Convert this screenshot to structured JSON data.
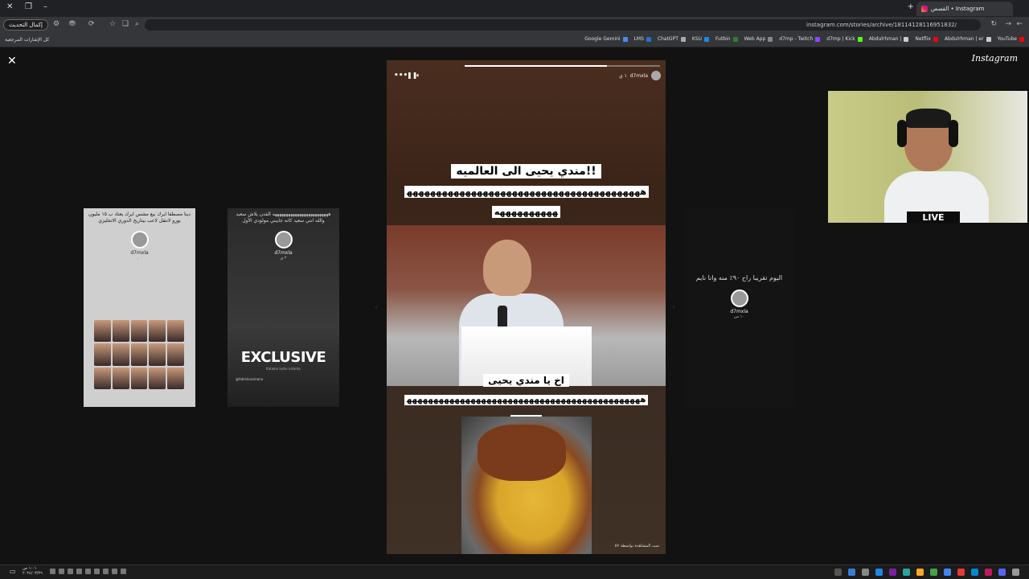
{
  "browser": {
    "tab_title": "القصص • Instagram",
    "url": "instagram.com/stories/archive/18114128116951832/",
    "update_button": "إكمال التحديث",
    "all_bookmarks": "كل الإشارات المرجعية",
    "bookmarks": [
      {
        "label": "Google Gemini",
        "color": "#4a8af4"
      },
      {
        "label": "LMS",
        "color": "#2c6fd1"
      },
      {
        "label": "ChatGPT",
        "color": "#aaaaaa"
      },
      {
        "label": "KSU",
        "color": "#1e88e5"
      },
      {
        "label": "Futbin",
        "color": "#2e7d32"
      },
      {
        "label": "Web App",
        "color": "#888888"
      },
      {
        "label": "d7mp - Twitch",
        "color": "#9146ff"
      },
      {
        "label": "d7mp | Kick",
        "color": "#53fc18"
      },
      {
        "label": "Abdulrhman |",
        "color": "#cccccc"
      },
      {
        "label": "Netflix",
        "color": "#e50914"
      },
      {
        "label": "Abdulrhman | er",
        "color": "#cccccc"
      },
      {
        "label": "YouTube",
        "color": "#ff0000"
      }
    ]
  },
  "page": {
    "logo": "Instagram"
  },
  "cards": {
    "left_far": {
      "text": "دينا مصطفا ايرك بيع مشس ايرك يعتاد ب ١٥ مليون يورو لانتقل لاعب بيتاريخ الدوري الانجليزي",
      "user": "d7mxla",
      "time": "١ ي"
    },
    "left_near": {
      "text": "هههههههههههههههههههههههههه الفدن يلاش سعيد والله انني سعيد كانه جايبني مولودي الأول",
      "user": "d7mxla",
      "time": "٢ ي",
      "headline": "EXCLUSIVE",
      "sub": "Kataloo lasko nalanto",
      "foot": "@fabrizioromano"
    },
    "right": {
      "text": "اليوم تقريبا راح ٩٠٪ منه وانا نايم",
      "user": "d7mxla",
      "time": "١٠ س"
    }
  },
  "story": {
    "user": "d7mxla",
    "time": "١ ي",
    "progress": 0.73,
    "caption_title": "مندي يحيى الى العالميه!!",
    "caption_laugh": "هههههههههههههههههههههههههههههههههههههههههههههههههههه",
    "caption_sub": "اخ يا مندي يحيى",
    "caption_laugh2": "هههههههههههههههههههههههههههههههههههههههههههههههههه",
    "seen_by": "تمت المشاهدة بواسطة ٥٧"
  },
  "webcam": {
    "badge": "LIVE"
  },
  "taskbar": {
    "time": "١:٠١ ص",
    "date": "٢٠٢٤/٠٣/٢٩"
  }
}
